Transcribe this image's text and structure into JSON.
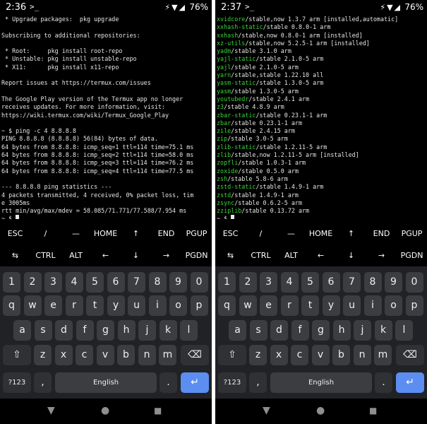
{
  "screens": [
    {
      "status": {
        "time": "2:36",
        "ssh": "&gt;_",
        "icons": "⚡▼◢",
        "battery": "76%"
      },
      "terminal": [
        {
          "t": " * Upgrade packages:  pkg upgrade"
        },
        {
          "t": ""
        },
        {
          "t": "Subscribing to additional repositories:"
        },
        {
          "t": ""
        },
        {
          "t": " * Root:     pkg install root-repo"
        },
        {
          "t": " * Unstable: pkg install unstable-repo"
        },
        {
          "t": " * X11:      pkg install x11-repo"
        },
        {
          "t": ""
        },
        {
          "t": "Report issues at https://termux.com/issues"
        },
        {
          "t": ""
        },
        {
          "t": "The Google Play version of the Termux app no longer"
        },
        {
          "t": "receives updates. For more information, visit:"
        },
        {
          "t": "https://wiki.termux.com/wiki/Termux_Google_Play"
        },
        {
          "t": ""
        },
        {
          "t": "~ $ ping -c 4 8.8.8.8"
        },
        {
          "t": "PING 8.8.8.8 (8.8.8.8) 56(84) bytes of data."
        },
        {
          "t": "64 bytes from 8.8.8.8: icmp_seq=1 ttl=114 time=75.1 ms"
        },
        {
          "t": "64 bytes from 8.8.8.8: icmp_seq=2 ttl=114 time=58.0 ms"
        },
        {
          "t": "64 bytes from 8.8.8.8: icmp_seq=3 ttl=114 time=76.2 ms"
        },
        {
          "t": "64 bytes from 8.8.8.8: icmp_seq=4 ttl=114 time=77.5 ms"
        },
        {
          "t": ""
        },
        {
          "t": "--- 8.8.8.8 ping statistics ---"
        },
        {
          "t": "4 packets transmitted, 4 received, 0% packet loss, tim"
        },
        {
          "t": "e 3005ms"
        },
        {
          "t": "rtt min/avg/max/mdev = 58.085/71.771/77.588/7.954 ms"
        },
        {
          "t": "~ $ ",
          "cursor": true
        }
      ]
    },
    {
      "status": {
        "time": "2:37",
        "ssh": "&gt;_",
        "icons": "⚡▼◢",
        "battery": "76%"
      },
      "terminal": [
        {
          "p": "xvidcore",
          "t": "/stable,now 1.3.7 arm [installed,automatic]"
        },
        {
          "p": "xxhash-static",
          "t": "/stable 0.8.0-1 arm"
        },
        {
          "p": "xxhash",
          "t": "/stable,now 0.8.0-1 arm [installed]"
        },
        {
          "p": "xz-utils",
          "t": "/stable,now 5.2.5-1 arm [installed]"
        },
        {
          "p": "yadm",
          "t": "/stable 3.1.0 arm"
        },
        {
          "p": "yajl-static",
          "t": "/stable 2.1.0-5 arm"
        },
        {
          "p": "yajl",
          "t": "/stable 2.1.0-5 arm"
        },
        {
          "p": "yarn",
          "t": "/stable,stable 1.22.10 all"
        },
        {
          "p": "yasm-static",
          "t": "/stable 1.3.0-5 arm"
        },
        {
          "p": "yasm",
          "t": "/stable 1.3.0-5 arm"
        },
        {
          "p": "youtubedr",
          "t": "/stable 2.4.1 arm"
        },
        {
          "p": "z3",
          "t": "/stable 4.8.9 arm"
        },
        {
          "p": "zbar-static",
          "t": "/stable 0.23.1-1 arm"
        },
        {
          "p": "zbar",
          "t": "/stable 0.23.1-1 arm"
        },
        {
          "p": "zile",
          "t": "/stable 2.4.15 arm"
        },
        {
          "p": "zip",
          "t": "/stable 3.0-5 arm"
        },
        {
          "p": "zlib-static",
          "t": "/stable 1.2.11-5 arm"
        },
        {
          "p": "zlib",
          "t": "/stable,now 1.2.11-5 arm [installed]"
        },
        {
          "p": "zopfli",
          "t": "/stable 1.0.3-1 arm"
        },
        {
          "p": "zoxide",
          "t": "/stable 0.5.0 arm"
        },
        {
          "p": "zsh",
          "t": "/stable 5.8-6 arm"
        },
        {
          "p": "zstd-static",
          "t": "/stable 1.4.9-1 arm"
        },
        {
          "p": "zstd",
          "t": "/stable 1.4.9-1 arm"
        },
        {
          "p": "zsync",
          "t": "/stable 0.6.2-5 arm"
        },
        {
          "p": "zziplib",
          "t": "/stable 0.13.72 arm"
        },
        {
          "t": "~ $ ",
          "cursor": true
        }
      ]
    }
  ],
  "extra_keys": {
    "row1": [
      "ESC",
      "/",
      "—",
      "HOME",
      "↑",
      "END",
      "PGUP"
    ],
    "row2": [
      "⇆",
      "CTRL",
      "ALT",
      "←",
      "↓",
      "→",
      "PGDN"
    ]
  },
  "keyboard": {
    "numbers": [
      "1",
      "2",
      "3",
      "4",
      "5",
      "6",
      "7",
      "8",
      "9",
      "0"
    ],
    "row_q": [
      "q",
      "w",
      "e",
      "r",
      "t",
      "y",
      "u",
      "i",
      "o",
      "p"
    ],
    "row_a": [
      "a",
      "s",
      "d",
      "f",
      "g",
      "h",
      "j",
      "k",
      "l"
    ],
    "row_z": [
      "z",
      "x",
      "c",
      "v",
      "b",
      "n",
      "m"
    ],
    "shift": "⇧",
    "backspace": "⌫",
    "symbols": "?123",
    "comma": ",",
    "space": "English",
    "period": ".",
    "enter": "↵"
  },
  "navbar": {
    "back": "▼",
    "home": "●",
    "recents": "■"
  }
}
